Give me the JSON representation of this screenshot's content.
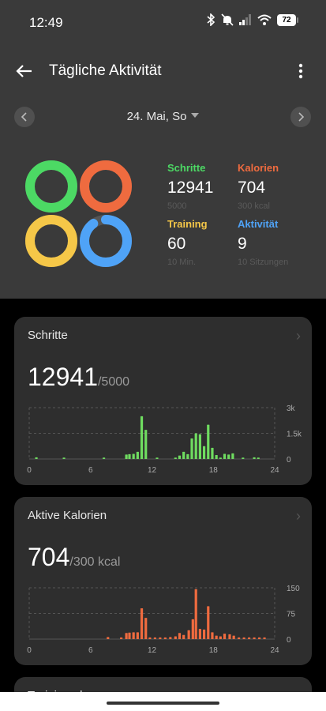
{
  "status_bar": {
    "time": "12:49",
    "battery": "72"
  },
  "header": {
    "title": "Tägliche Aktivität"
  },
  "date_nav": {
    "date": "24. Mai, So"
  },
  "summary": {
    "steps": {
      "label": "Schritte",
      "value": "12941",
      "goal": "5000",
      "color": "#4cd964"
    },
    "calories": {
      "label": "Kalorien",
      "value": "704",
      "goal": "300 kcal",
      "color": "#ef6b3f"
    },
    "training": {
      "label": "Training",
      "value": "60",
      "goal": "10 Min.",
      "color": "#f5c748"
    },
    "activity": {
      "label": "Aktivität",
      "value": "9",
      "goal": "10 Sitzungen",
      "color": "#4fa3f7"
    }
  },
  "rings": [
    {
      "name": "steps",
      "color": "#4cd964",
      "progress": 1.0
    },
    {
      "name": "calories",
      "color": "#ef6b3f",
      "progress": 1.0
    },
    {
      "name": "training",
      "color": "#f5c748",
      "progress": 1.0
    },
    {
      "name": "activity",
      "color": "#4fa3f7",
      "progress": 0.9
    }
  ],
  "cards": {
    "steps": {
      "title": "Schritte",
      "value": "12941",
      "goal": "/5000"
    },
    "calories": {
      "title": "Aktive Kalorien",
      "value": "704",
      "goal": "/300 kcal"
    },
    "training": {
      "title": "Trainingsdauer"
    }
  },
  "chart_data": [
    {
      "type": "bar",
      "name": "steps",
      "color": "#6fdc60",
      "x_ticks": [
        "0",
        "6",
        "12",
        "18",
        "24"
      ],
      "y_ticks": [
        "3k",
        "1.5k",
        "0"
      ],
      "ylim": [
        0,
        3000
      ],
      "xlim": [
        0,
        24
      ],
      "points": [
        [
          0.7,
          100
        ],
        [
          3.4,
          80
        ],
        [
          7.3,
          80
        ],
        [
          9.5,
          260
        ],
        [
          9.8,
          280
        ],
        [
          10.2,
          300
        ],
        [
          10.6,
          420
        ],
        [
          11.0,
          2500
        ],
        [
          11.4,
          1700
        ],
        [
          12.5,
          80
        ],
        [
          14.3,
          80
        ],
        [
          14.7,
          200
        ],
        [
          15.1,
          420
        ],
        [
          15.5,
          280
        ],
        [
          15.9,
          1200
        ],
        [
          16.3,
          1500
        ],
        [
          16.7,
          1450
        ],
        [
          17.1,
          750
        ],
        [
          17.5,
          2000
        ],
        [
          17.9,
          650
        ],
        [
          18.3,
          230
        ],
        [
          18.7,
          80
        ],
        [
          19.1,
          300
        ],
        [
          19.5,
          260
        ],
        [
          19.9,
          330
        ],
        [
          20.9,
          80
        ],
        [
          22.0,
          100
        ],
        [
          22.4,
          80
        ]
      ]
    },
    {
      "type": "bar",
      "name": "calories",
      "color": "#ef6b3f",
      "x_ticks": [
        "0",
        "6",
        "12",
        "18",
        "24"
      ],
      "y_ticks": [
        "150",
        "75",
        "0"
      ],
      "ylim": [
        0,
        150
      ],
      "xlim": [
        0,
        24
      ],
      "points": [
        [
          7.7,
          6
        ],
        [
          9.0,
          5
        ],
        [
          9.5,
          18
        ],
        [
          9.8,
          19
        ],
        [
          10.2,
          20
        ],
        [
          10.6,
          20
        ],
        [
          11.0,
          90
        ],
        [
          11.4,
          62
        ],
        [
          11.8,
          5
        ],
        [
          12.3,
          5
        ],
        [
          12.8,
          5
        ],
        [
          13.3,
          5
        ],
        [
          13.8,
          6
        ],
        [
          14.3,
          8
        ],
        [
          14.7,
          18
        ],
        [
          15.1,
          12
        ],
        [
          15.6,
          26
        ],
        [
          16.0,
          58
        ],
        [
          16.3,
          146
        ],
        [
          16.7,
          30
        ],
        [
          17.1,
          28
        ],
        [
          17.5,
          96
        ],
        [
          17.9,
          20
        ],
        [
          18.3,
          10
        ],
        [
          18.7,
          8
        ],
        [
          19.1,
          16
        ],
        [
          19.6,
          14
        ],
        [
          20.0,
          10
        ],
        [
          20.5,
          5
        ],
        [
          21.0,
          5
        ],
        [
          21.5,
          5
        ],
        [
          22.0,
          5
        ],
        [
          22.5,
          5
        ],
        [
          23.0,
          5
        ]
      ]
    }
  ]
}
